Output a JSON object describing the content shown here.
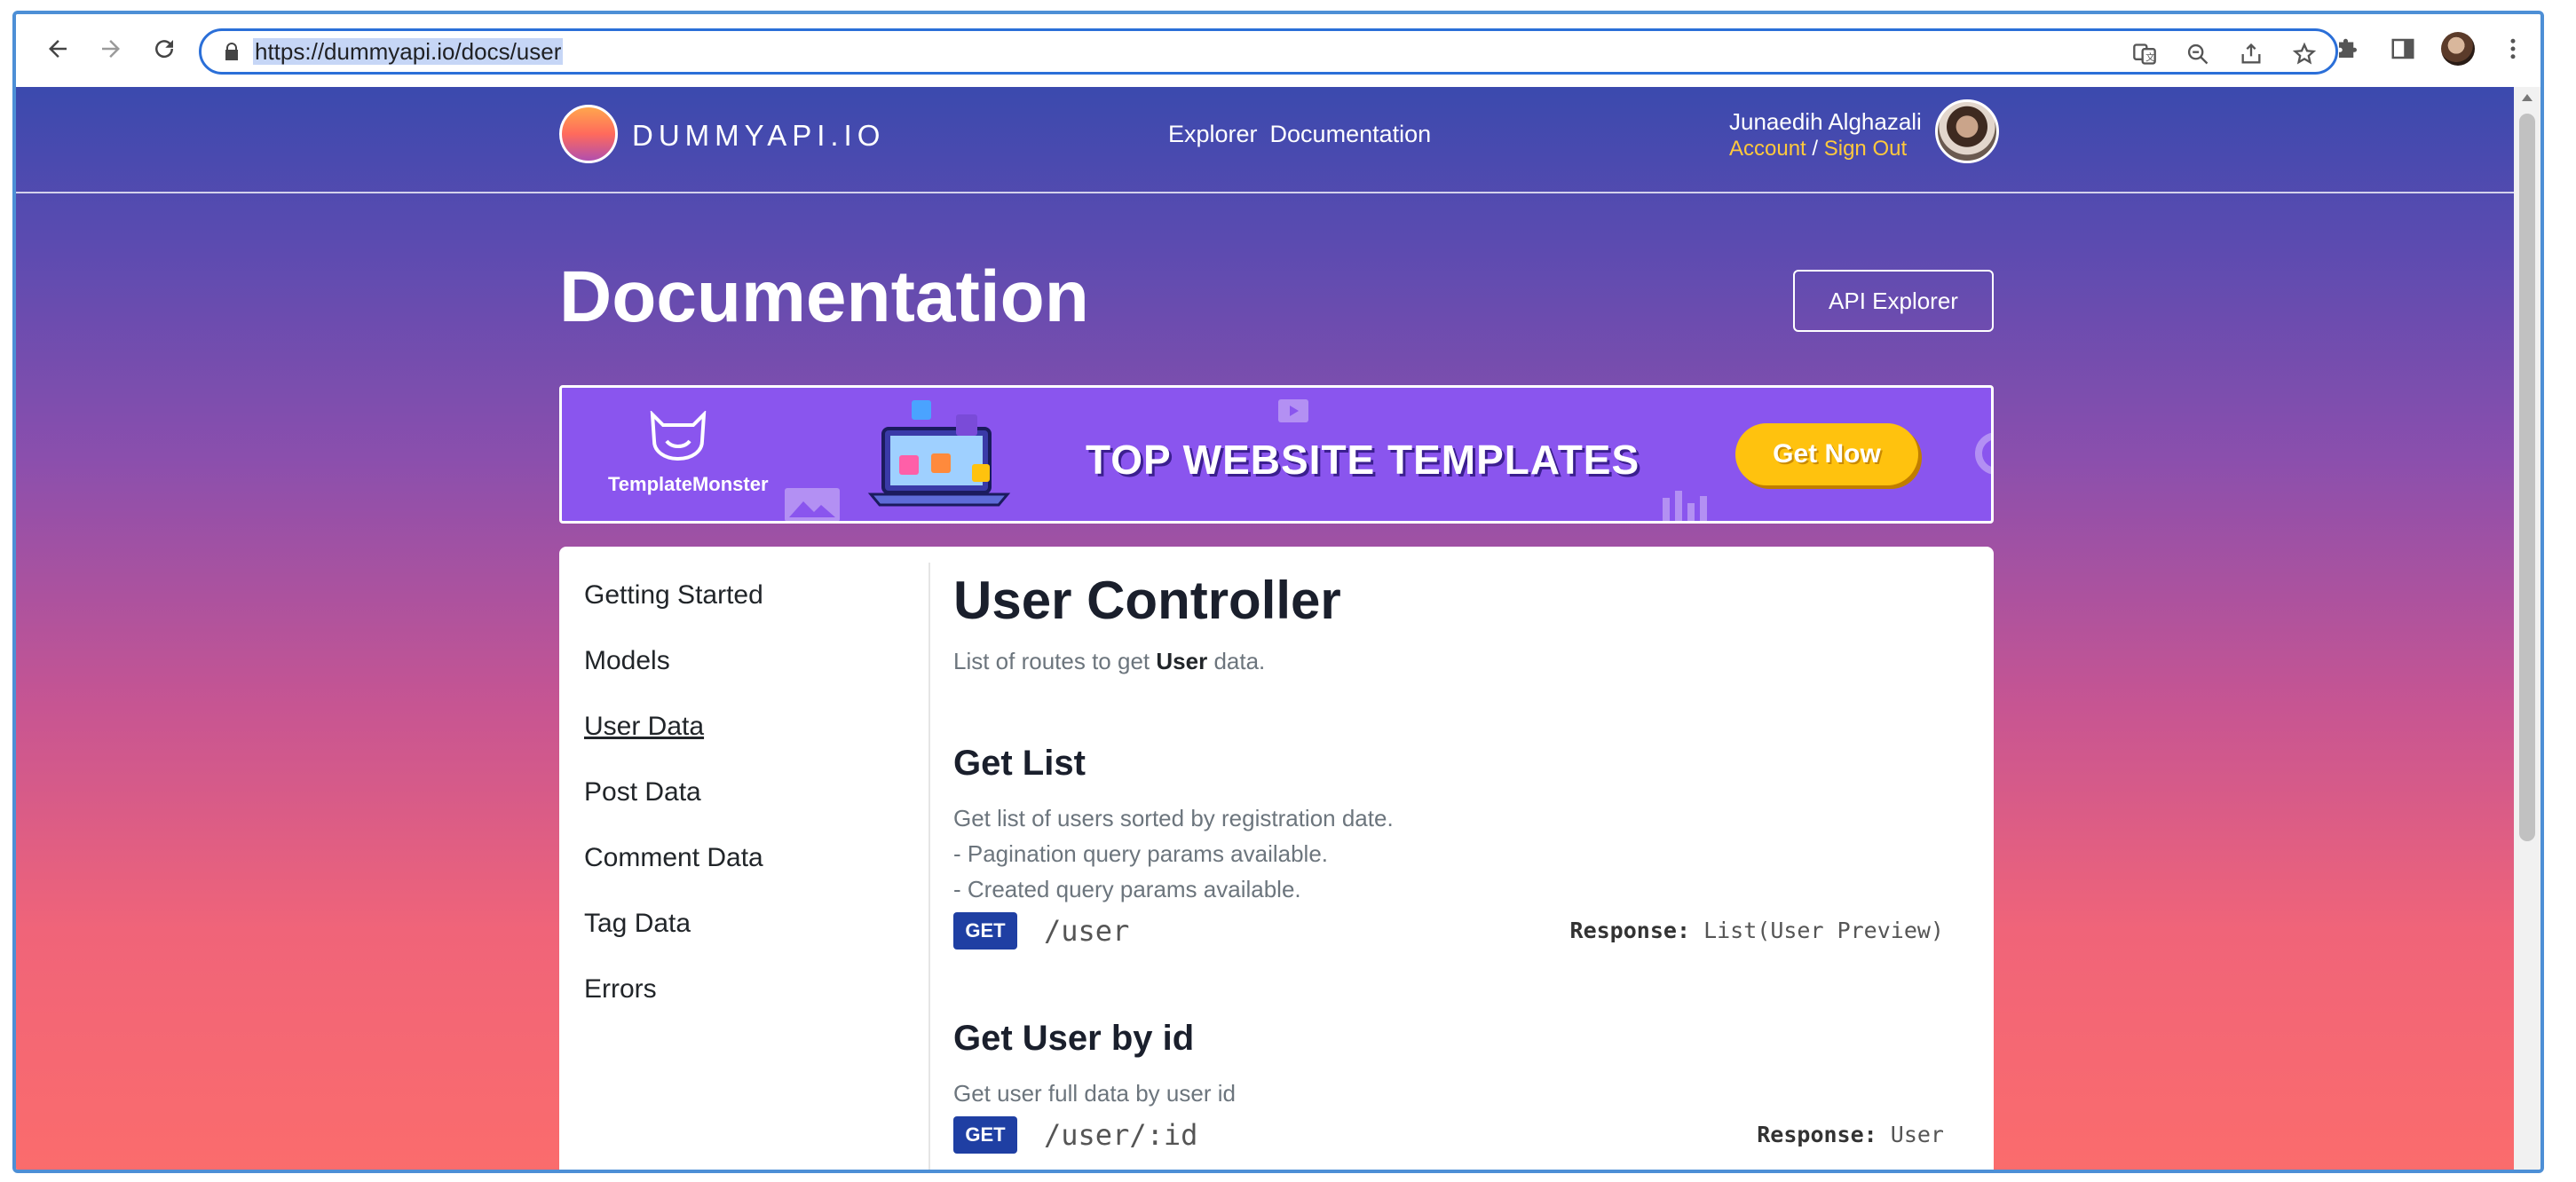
{
  "browser": {
    "url": "https://dummyapi.io/docs/user",
    "toolbar_icons": [
      "back-icon",
      "forward-icon",
      "reload-icon"
    ],
    "omnibox_icons": [
      "translate-icon",
      "zoom-out-icon",
      "share-icon",
      "bookmark-star-icon"
    ],
    "extension_icons": [
      "extensions-puzzle-icon",
      "side-panel-icon",
      "profile-avatar",
      "more-menu-icon"
    ]
  },
  "site": {
    "logo_text": "DUMMYAPI.IO",
    "nav": [
      "Explorer",
      "Documentation"
    ],
    "user_name": "Junaedih Alghazali",
    "account_label": "Account",
    "separator": "/",
    "sign_out_label": "Sign Out"
  },
  "header": {
    "title": "Documentation",
    "api_explorer_label": "API Explorer"
  },
  "banner": {
    "brand": "TemplateMonster",
    "headline": "TOP WEBSITE TEMPLATES",
    "cta": "Get Now",
    "background_color": "#8a55ee",
    "cta_color": "#ffc20e"
  },
  "sidebar": {
    "items": [
      {
        "label": "Getting Started",
        "active": false
      },
      {
        "label": "Models",
        "active": false
      },
      {
        "label": "User Data",
        "active": true
      },
      {
        "label": "Post Data",
        "active": false
      },
      {
        "label": "Comment Data",
        "active": false
      },
      {
        "label": "Tag Data",
        "active": false
      },
      {
        "label": "Errors",
        "active": false
      }
    ]
  },
  "content": {
    "title": "User Controller",
    "subtitle_prefix": "List of routes to get",
    "subtitle_bold": "User",
    "subtitle_suffix": "data.",
    "endpoints": [
      {
        "heading": "Get List",
        "description": [
          "Get list of users sorted by registration date.",
          "- Pagination query params available.",
          "- Created query params available."
        ],
        "method": "GET",
        "path": "/user",
        "response_label": "Response:",
        "response_value": "List(User Preview)"
      },
      {
        "heading": "Get User by id",
        "description": [
          "Get user full data by user id"
        ],
        "method": "GET",
        "path": "/user/:id",
        "response_label": "Response:",
        "response_value": "User"
      }
    ]
  },
  "colors": {
    "method_badge": "#1f3fa3",
    "omnibox_border": "#2b6fd8",
    "link_accent": "#ffc93c"
  }
}
